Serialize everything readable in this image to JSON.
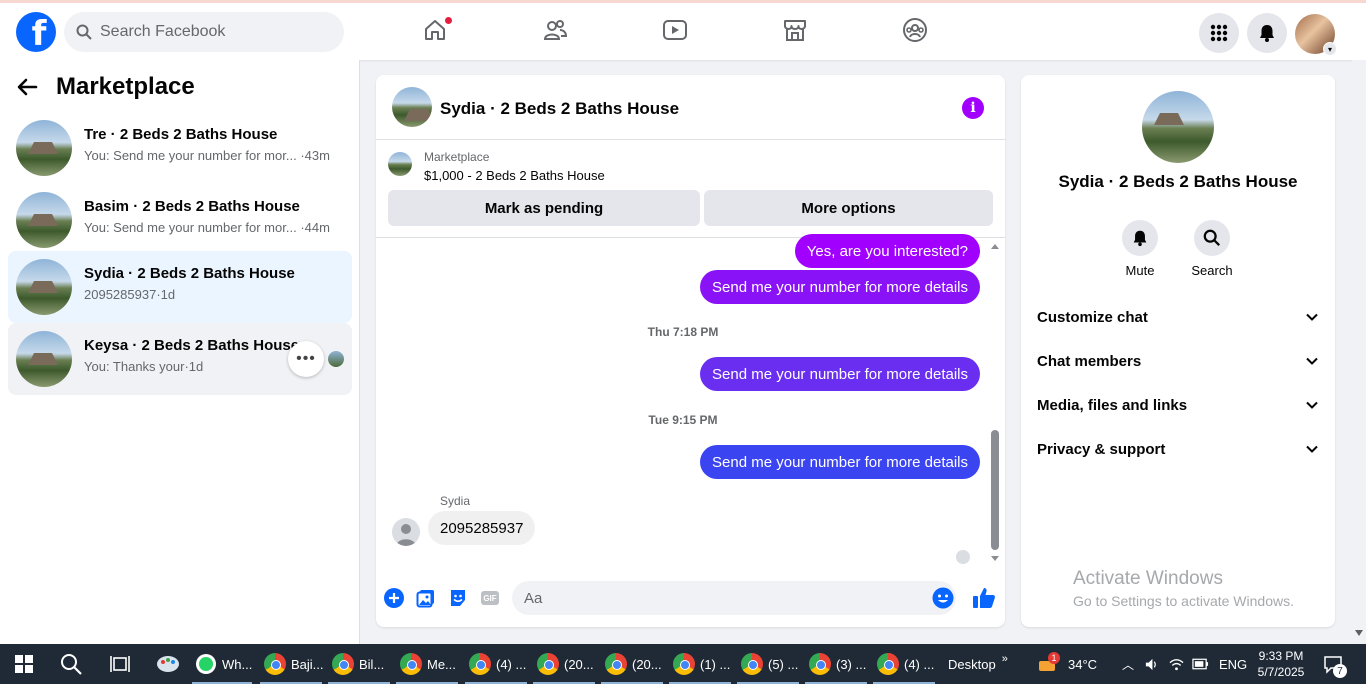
{
  "topbar": {
    "logo": "f",
    "search_placeholder": "Search Facebook",
    "nav_icons": [
      "home-icon",
      "friends-icon",
      "video-icon",
      "marketplace-icon",
      "groups-icon"
    ],
    "right_icons": [
      "menu-grid-icon",
      "notifications-bell-icon",
      "profile-avatar"
    ]
  },
  "sidebar": {
    "title": "Marketplace",
    "conversations": [
      {
        "name": "Tre · 2 Beds 2 Baths House",
        "preview": "You: Send me your number for mor...",
        "time": "·43m"
      },
      {
        "name": "Basim · 2 Beds 2 Baths House",
        "preview": "You: Send me your number for mor...",
        "time": "·44m"
      },
      {
        "name": "Sydia · 2 Beds 2 Baths House",
        "preview": "2095285937",
        "time": "·1d"
      },
      {
        "name": "Keysa · 2 Beds 2 Baths House",
        "preview": "You: Thanks your",
        "time": "·1d"
      }
    ]
  },
  "chat": {
    "title": "Sydia · 2 Beds 2 Baths House",
    "listing_label": "Marketplace",
    "listing_price": "$1,000 - 2 Beds 2 Baths House",
    "mark_pending": "Mark as pending",
    "more_options": "More options",
    "messages": {
      "m1": "Yes, are you interested?",
      "m2": "Send me your number for more details",
      "ts1": "Thu 7:18 PM",
      "m3": "Send me your number for more details",
      "ts2": "Tue 9:15 PM",
      "m4": "Send me your number for more details",
      "sender": "Sydia",
      "m5": "2095285937"
    },
    "input_placeholder": "Aa",
    "gif_label": "GIF"
  },
  "details": {
    "title": "Sydia · 2 Beds 2 Baths House",
    "mute": "Mute",
    "search": "Search",
    "options": [
      "Customize chat",
      "Chat members",
      "Media, files and links",
      "Privacy & support"
    ]
  },
  "watermark": {
    "line1": "Activate Windows",
    "line2": "Go to Settings to activate Windows."
  },
  "taskbar": {
    "items": [
      "Wh...",
      "Baji...",
      "Bil...",
      "Me...",
      "(4) ...",
      "(20...",
      "(20...",
      "(1) ...",
      "(5) ...",
      "(3) ...",
      "(4) ..."
    ],
    "desktop": "Desktop",
    "weather_badge": "1",
    "temp": "34°C",
    "lang": "ENG",
    "time": "9:33 PM",
    "date": "5/7/2025",
    "notif_count": "7"
  },
  "colors": {
    "brand": "#0866ff",
    "bubble_purple": "#a100ff",
    "bubble_violet": "#7b3bf2",
    "bubble_blue": "#3a44f0"
  }
}
